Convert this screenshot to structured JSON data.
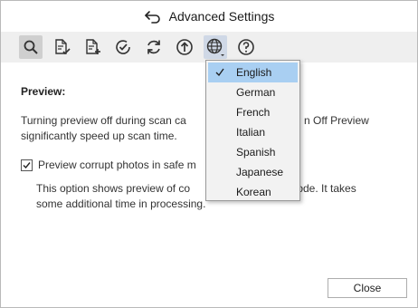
{
  "window": {
    "title": "Advanced Settings"
  },
  "toolbar": {
    "buttons": [
      {
        "icon": "search-icon",
        "state": "active"
      },
      {
        "icon": "document-check-icon"
      },
      {
        "icon": "document-add-icon"
      },
      {
        "icon": "check-circle-icon"
      },
      {
        "icon": "refresh-icon"
      },
      {
        "icon": "upload-icon"
      },
      {
        "icon": "globe-icon",
        "state": "open"
      },
      {
        "icon": "help-icon"
      }
    ]
  },
  "preview": {
    "title": "Preview:",
    "description": "Turning preview off during scan can significantly speed up scan time. You can Turn Off Preview",
    "description_visible_line1_a": "Turning preview off during scan ca",
    "description_visible_line1_b": "n Off Preview",
    "description_visible_line2": "significantly speed up scan time.",
    "checkbox_label": "Preview corrupt photos in safe m",
    "checkbox_checked": true,
    "checkbox_desc_a": "This option shows preview of co",
    "checkbox_desc_b": "fe mode. It takes",
    "checkbox_desc_line2": "some additional time in processing."
  },
  "language_menu": {
    "items": [
      "English",
      "German",
      "French",
      "Italian",
      "Spanish",
      "Japanese",
      "Korean"
    ],
    "selected": "English"
  },
  "footer": {
    "close_label": "Close"
  },
  "colors": {
    "toolbar_bg": "#efefef",
    "active_button_bg": "#cfcfcf",
    "menu_selected_bg": "#a9cff2",
    "menu_bg": "#f2f2f2"
  }
}
